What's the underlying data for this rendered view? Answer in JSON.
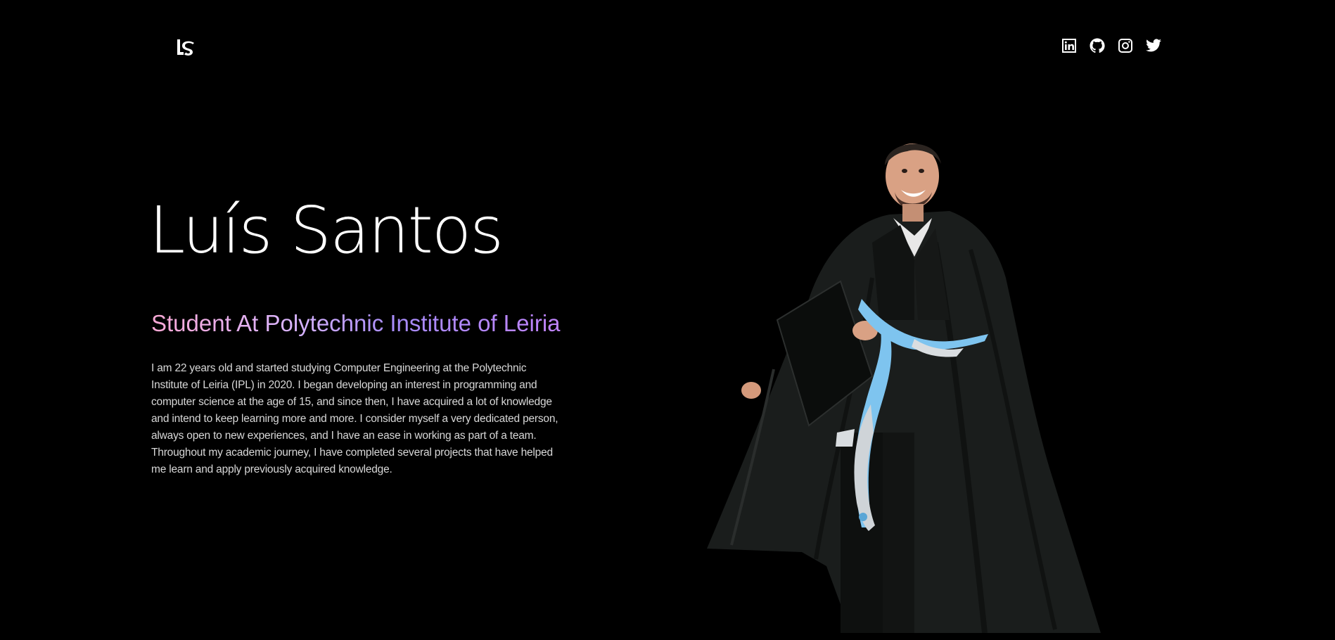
{
  "header": {
    "logo_text": "LS",
    "social_links": [
      {
        "name": "linkedin-icon"
      },
      {
        "name": "github-icon"
      },
      {
        "name": "instagram-icon"
      },
      {
        "name": "twitter-icon"
      }
    ]
  },
  "hero": {
    "name": "Luís Santos",
    "subtitle": "Student At Polytechnic Institute of Leiria",
    "bio": "I am 22 years old and started studying Computer Engineering at the Polytechnic Institute of Leiria (IPL) in 2020. I began developing an interest in programming and computer science at the age of 15, and since then, I have acquired a lot of knowledge and intend to keep learning more and more. I consider myself a very dedicated person, always open to new experiences, and I have an ease in working as part of a team. Throughout my academic journey, I have completed several projects that have helped me learn and apply previously acquired knowledge."
  },
  "colors": {
    "background": "#000000",
    "text": "#ffffff",
    "gradient_start": "#f9a8d4",
    "gradient_end": "#a78bfa",
    "ribbon": "#7ec4ef"
  }
}
